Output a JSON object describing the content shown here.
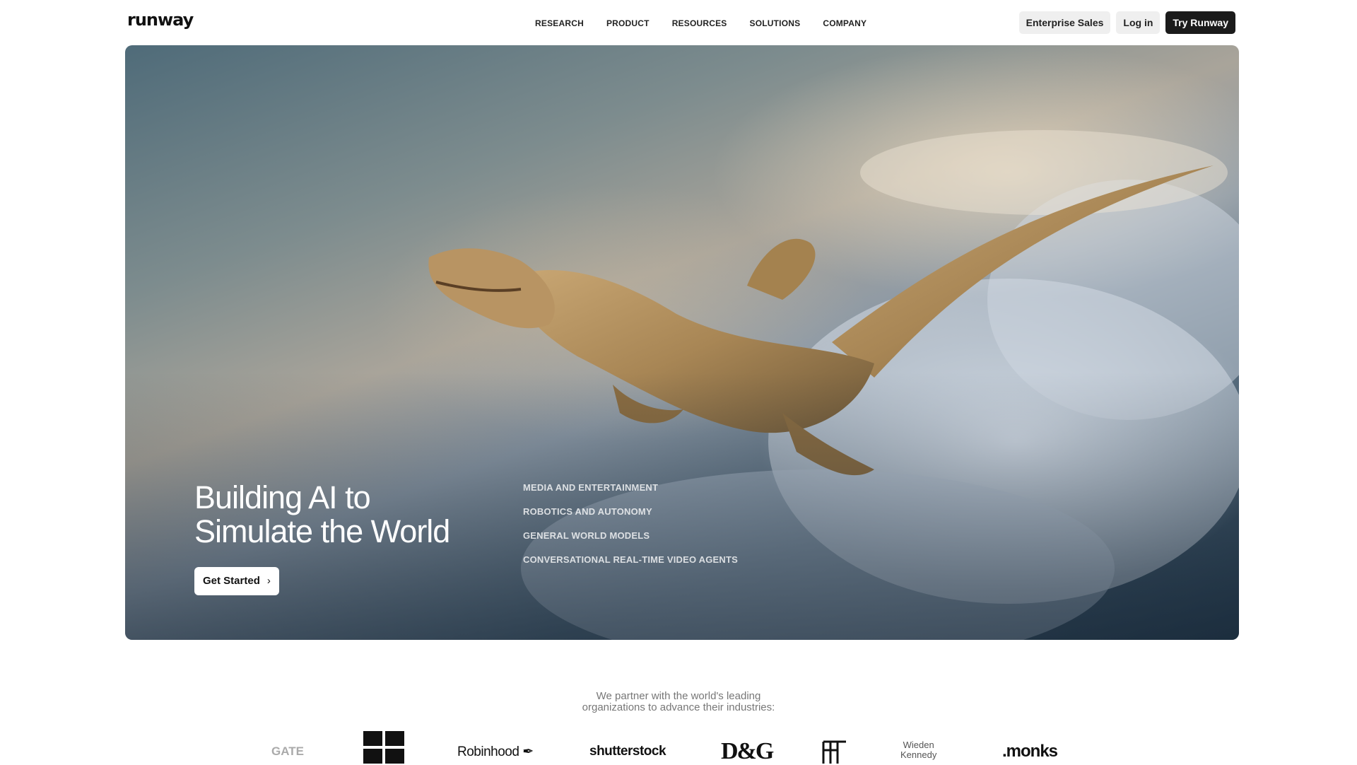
{
  "nav": {
    "logo": "runway",
    "menu": [
      "RESEARCH",
      "PRODUCT",
      "RESOURCES",
      "SOLUTIONS",
      "COMPANY"
    ],
    "enterprise_label": "Enterprise Sales",
    "login_label": "Log in",
    "try_label": "Try Runway"
  },
  "hero": {
    "title_line1": "Building AI to",
    "title_line2": "Simulate the World",
    "cta_label": "Get Started",
    "cta_icon": "chevron-right-icon",
    "solutions": [
      "MEDIA AND ENTERTAINMENT",
      "ROBOTICS AND AUTONOMY",
      "GENERAL WORLD MODELS",
      "CONVERSATIONAL REAL-TIME VIDEO AGENTS"
    ]
  },
  "partners": {
    "caption_line1": "We partner with the world's leading",
    "caption_line2": "organizations to advance their industries:",
    "logos": [
      "GATE",
      "Robinhood",
      "shutterstock",
      "D&G",
      "Wieden",
      "Kennedy",
      ".monks"
    ]
  },
  "colors": {
    "accent_dark": "#1b1b1b",
    "button_light": "#efefef",
    "caption_gray": "#777777"
  }
}
